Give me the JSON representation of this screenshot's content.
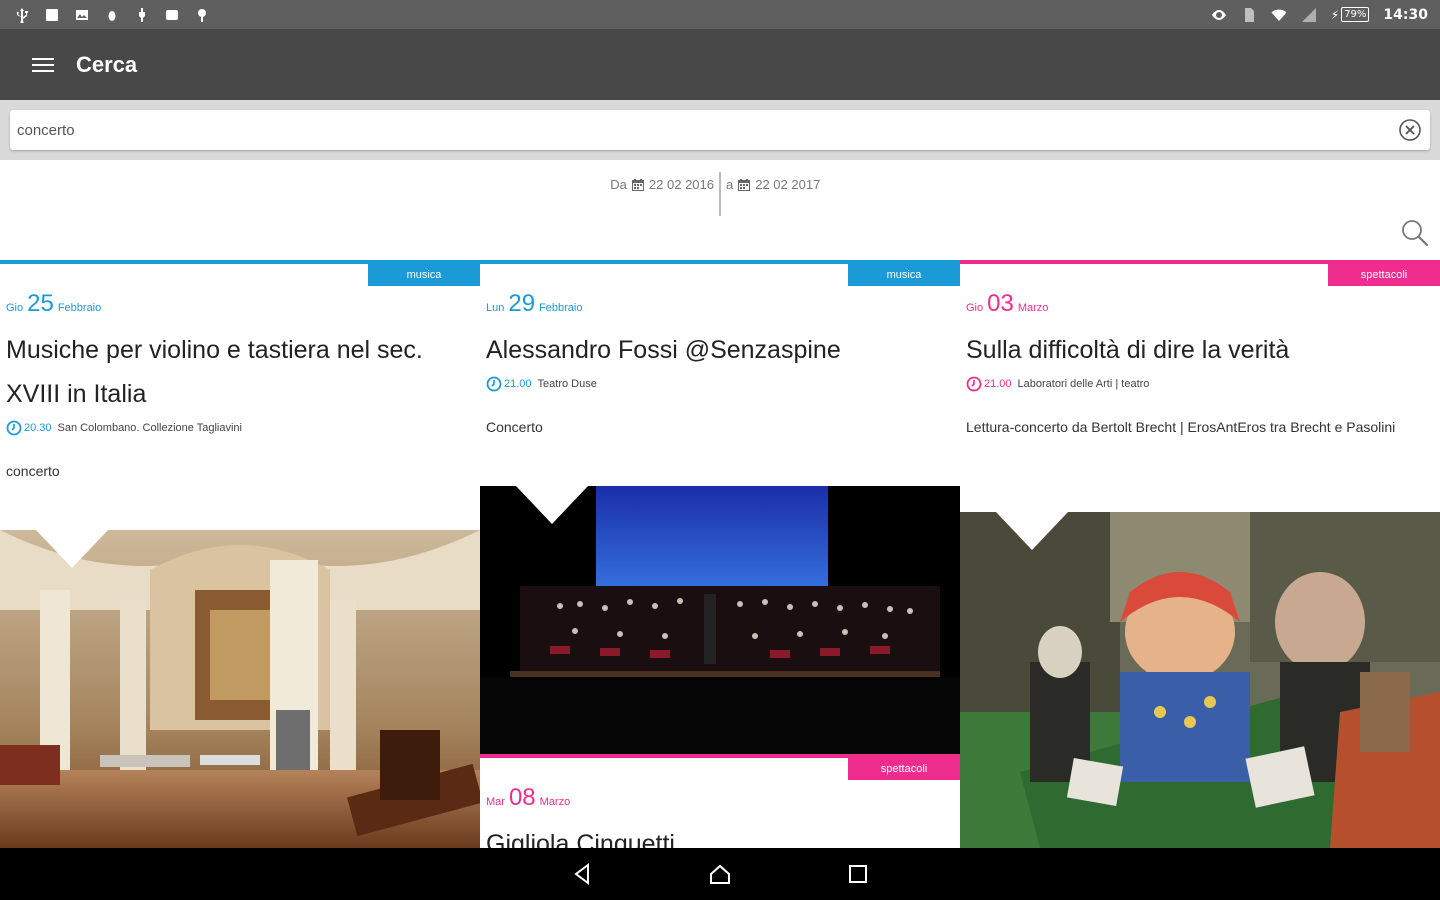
{
  "statusbar": {
    "battery": "79%",
    "time": "14:30"
  },
  "appbar": {
    "title": "Cerca"
  },
  "search": {
    "value": "concerto"
  },
  "daterange": {
    "from_label": "Da",
    "from_date": "22 02 2016",
    "to_label": "a",
    "to_date": "22 02 2017"
  },
  "colors": {
    "musica": "#1a9ad6",
    "spettacoli": "#ee2d8e"
  },
  "events": [
    {
      "category": "musica",
      "weekday": "Gio",
      "day": "25",
      "month": "Febbraio",
      "title": "Musiche per violino e tastiera nel sec. XVIII in Italia",
      "time": "20.30",
      "location": "San Colombano. Collezione Tagliavini",
      "description": "concerto",
      "image": "church-interior-with-harpsichord"
    },
    {
      "category": "musica",
      "weekday": "Lun",
      "day": "29",
      "month": "Febbraio",
      "title": "Alessandro Fossi @Senzaspine",
      "time": "21.00",
      "location": "Teatro Duse",
      "description": "Concerto",
      "image": "orchestra-on-stage"
    },
    {
      "category": "spettacoli",
      "weekday": "Gio",
      "day": "03",
      "month": "Marzo",
      "title": "Sulla difficoltà di dire la verità",
      "time": "21.00",
      "location": "Laboratori delle Arti | teatro",
      "description": "Lettura-concerto da Bertolt Brecht | ErosAntEros tra Brecht e Pasolini",
      "image": "expressionist-painting"
    },
    {
      "category": "spettacoli",
      "weekday": "Mar",
      "day": "08",
      "month": "Marzo",
      "title": "Gigliola Cinquetti"
    }
  ]
}
